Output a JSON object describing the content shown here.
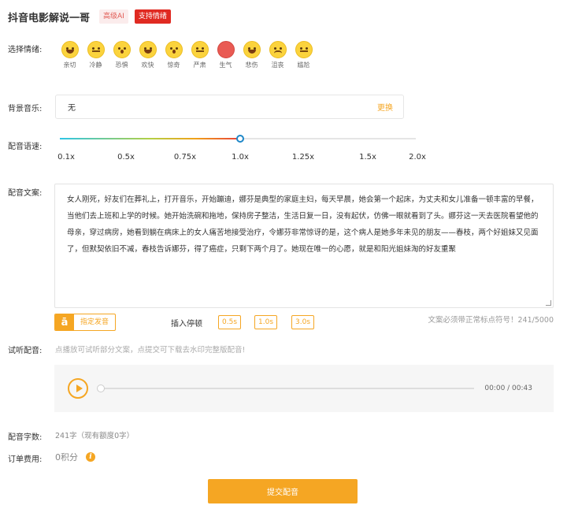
{
  "header": {
    "voice_name": "抖音电影解说一哥",
    "badge_ai": "高级AI",
    "badge_emotion": "支持情绪"
  },
  "emotion": {
    "label": "选择情绪:",
    "items": [
      {
        "label": "亲切",
        "icon": "grin-face-icon"
      },
      {
        "label": "冷静",
        "icon": "neutral-face-icon"
      },
      {
        "label": "恐惧",
        "icon": "fearful-face-icon"
      },
      {
        "label": "欢快",
        "icon": "joyful-face-icon"
      },
      {
        "label": "惊奇",
        "icon": "surprised-face-icon"
      },
      {
        "label": "严肃",
        "icon": "serious-face-icon"
      },
      {
        "label": "生气",
        "icon": "angry-face-icon"
      },
      {
        "label": "悲伤",
        "icon": "sad-face-icon"
      },
      {
        "label": "沮丧",
        "icon": "frustrated-face-icon"
      },
      {
        "label": "尴尬",
        "icon": "awkward-face-icon"
      }
    ]
  },
  "music": {
    "label": "背景音乐:",
    "value": "无",
    "change_label": "更换"
  },
  "speed": {
    "label": "配音语速:",
    "value": 1.0,
    "ticks": [
      "0.1x",
      "0.5x",
      "0.75x",
      "1.0x",
      "1.25x",
      "1.5x",
      "2.0x"
    ]
  },
  "script": {
    "label": "配音文案:",
    "text": "女人刚死，好友们在葬礼上，打开音乐，开始蹦迪，娜芬是典型的家庭主妇，每天早晨，她会第一个起床，为丈夫和女儿准备一顿丰富的早餐，当他们去上班和上学的时候。她开始洗碗和拖地，保持房子整洁，生活日复一日，没有起伏，仿佛一眼就看到了头。娜芬这一天去医院看望他的母亲，穿过病房，她看到躺在病床上的女人痛苦地接受治疗，令娜芬非常惊讶的是，这个病人是她多年未见的朋友——春枝，两个好姐妹又见面了，但默契依旧不减，春枝告诉娜芬，得了癌症，只剩下两个月了。她现在唯一的心愿，就是和阳光姐妹淘的好友重聚",
    "polyphone_label": "指定发音",
    "pause_label": "插入停顿",
    "pauses": [
      "0.5s",
      "1.0s",
      "3.0s"
    ],
    "hint": "文案必须带正常标点符号！241/5000"
  },
  "listen": {
    "label": "试听配音:",
    "desc": "点播放可试听部分文案，点提交可下载去水印完整版配音!",
    "progress": 0,
    "time": "00:00 / 00:43"
  },
  "count": {
    "label": "配音字数:",
    "value": "241字（现有额度0字）"
  },
  "fee": {
    "label": "订单费用:",
    "value": "0积分"
  },
  "submit_label": "提交配音"
}
